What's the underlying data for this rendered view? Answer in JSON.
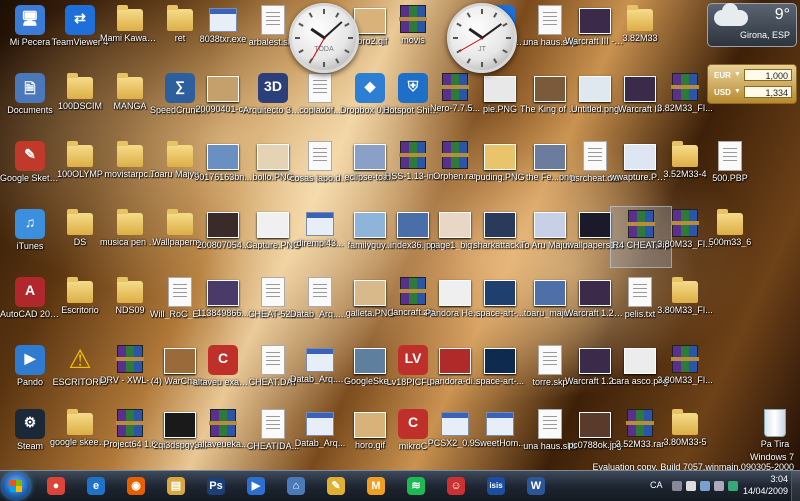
{
  "colors": {
    "taskbar": "#1e2632",
    "selection": "#a0bee6",
    "currency_panel": "#b88a2e"
  },
  "desktop": {
    "icons": [
      {
        "label": "Mi Pecera",
        "type": "app",
        "glyph": "🖥",
        "color": "#3a7bd5",
        "col": 0,
        "row": 0,
        "icon_name": "computer-icon"
      },
      {
        "label": "TeamViewer 4",
        "type": "app",
        "glyph": "⇄",
        "color": "#1e6fd9",
        "col": 1,
        "row": 0,
        "icon_name": "teamviewer-icon"
      },
      {
        "label": "Mami Kawada - ...",
        "type": "folder",
        "col": 2,
        "row": 0,
        "icon_name": "folder-icon"
      },
      {
        "label": "ret",
        "type": "folder",
        "col": 3,
        "row": 0,
        "icon_name": "folder-icon"
      },
      {
        "label": "8038txr.exe",
        "type": "exe",
        "col": 4,
        "row": 0,
        "icon_name": "exe-icon"
      },
      {
        "label": "arbalest.skp",
        "type": "doc",
        "col": 5,
        "row": 0,
        "icon_name": "sketchup-file-icon"
      },
      {
        "label": "horo2.gif",
        "type": "thumb",
        "color": "#d9b27a",
        "col": 7,
        "row": 0,
        "icon_name": "image-icon"
      },
      {
        "label": "movis",
        "type": "winrar",
        "col": 8,
        "row": 0,
        "icon_name": "winrar-icon"
      },
      {
        "label": "TeamViewe... (1).exe",
        "type": "app",
        "glyph": "⇄",
        "color": "#1e6fd9",
        "col": 10,
        "row": 0,
        "icon_name": "teamviewer-icon"
      },
      {
        "label": "una haus.skp",
        "type": "doc",
        "col": 11,
        "row": 0,
        "icon_name": "sketchup-file-icon"
      },
      {
        "label": "Warcraft III - The Frozen ...",
        "type": "thumb",
        "color": "#3b2a4a",
        "col": 12,
        "row": 0,
        "icon_name": "warcraft-icon"
      },
      {
        "label": "3.82M33",
        "type": "folder",
        "col": 13,
        "row": 0,
        "icon_name": "folder-icon"
      },
      {
        "label": "Documents",
        "type": "app",
        "glyph": "🗎",
        "color": "#4a78b8",
        "col": 0,
        "row": 1,
        "icon_name": "documents-icon"
      },
      {
        "label": "100DSCIM",
        "type": "folder",
        "col": 1,
        "row": 1,
        "icon_name": "folder-icon"
      },
      {
        "label": "MANGA",
        "type": "folder",
        "col": 2,
        "row": 1,
        "icon_name": "folder-icon"
      },
      {
        "label": "SpeedCrunch (calc)",
        "type": "app",
        "glyph": "∑",
        "color": "#2d5e9e",
        "col": 3,
        "row": 1,
        "icon_name": "calculator-icon"
      },
      {
        "label": "20090401-c...",
        "type": "thumb",
        "color": "#c5a06a",
        "col": 4,
        "row": 1,
        "icon_name": "image-icon"
      },
      {
        "label": "Arquitecto 3D 7.0",
        "type": "app",
        "glyph": "3D",
        "color": "#2b3f7a",
        "col": 5,
        "row": 1,
        "icon_name": "arquitecto-3d-icon"
      },
      {
        "label": "copiadof...",
        "type": "doc",
        "col": 6,
        "row": 1,
        "icon_name": "document-icon"
      },
      {
        "label": "Dropbox 0.6.402.exe",
        "type": "app",
        "glyph": "◆",
        "color": "#2d7fd3",
        "col": 7,
        "row": 1,
        "icon_name": "dropbox-icon"
      },
      {
        "label": "Hotspot Shield...",
        "type": "app",
        "glyph": "⛨",
        "color": "#1d6fc7",
        "col": 8,
        "row": 1,
        "icon_name": "hotspot-shield-icon"
      },
      {
        "label": "Nero-7.7.5...",
        "type": "winrar",
        "col": 9,
        "row": 1,
        "icon_name": "winrar-icon"
      },
      {
        "label": "pie.PNG",
        "type": "thumb",
        "color": "#e8e8e8",
        "col": 10,
        "row": 1,
        "icon_name": "image-icon"
      },
      {
        "label": "The King of Fallen...mp3",
        "type": "thumb",
        "color": "#7a5a3a",
        "col": 11,
        "row": 1,
        "icon_name": "audio-file-icon"
      },
      {
        "label": "Untitled.png",
        "type": "thumb",
        "color": "#dfe7ef",
        "col": 12,
        "row": 1,
        "icon_name": "image-icon"
      },
      {
        "label": "Warcraft III",
        "type": "thumb",
        "color": "#3b2a4a",
        "col": 13,
        "row": 1,
        "icon_name": "warcraft-icon"
      },
      {
        "label": "3.82M33_FI...",
        "type": "winrar",
        "col": 14,
        "row": 1,
        "icon_name": "winrar-icon"
      },
      {
        "label": "Google SketchUp",
        "type": "app",
        "glyph": "✎",
        "color": "#c0392b",
        "col": 0,
        "row": 2,
        "icon_name": "sketchup-icon"
      },
      {
        "label": "100OLYMP",
        "type": "folder",
        "col": 1,
        "row": 2,
        "icon_name": "folder-icon"
      },
      {
        "label": "movistarpc...",
        "type": "folder",
        "col": 2,
        "row": 2,
        "icon_name": "folder-icon"
      },
      {
        "label": "Toaru Majyutsu...",
        "type": "folder",
        "col": 3,
        "row": 2,
        "icon_name": "folder-icon"
      },
      {
        "label": "90176163bn...",
        "type": "thumb",
        "color": "#6a8fc2",
        "col": 4,
        "row": 2,
        "icon_name": "image-icon"
      },
      {
        "label": "bollo.PNG",
        "type": "thumb",
        "color": "#e5d3b5",
        "col": 5,
        "row": 2,
        "icon_name": "image-icon"
      },
      {
        "label": "cosas japo.docx",
        "type": "doc",
        "col": 6,
        "row": 2,
        "icon_name": "word-document-icon"
      },
      {
        "label": "eclipse-toa...",
        "type": "thumb",
        "color": "#8aa0c6",
        "col": 7,
        "row": 2,
        "icon_name": "image-icon"
      },
      {
        "label": "HSS-1.13-in...",
        "type": "winrar",
        "col": 8,
        "row": 2,
        "icon_name": "winrar-icon"
      },
      {
        "label": "Orphen.rar",
        "type": "winrar",
        "col": 9,
        "row": 2,
        "icon_name": "winrar-icon"
      },
      {
        "label": "puding.PNG",
        "type": "thumb",
        "color": "#e9c46a",
        "col": 10,
        "row": 2,
        "icon_name": "image-icon"
      },
      {
        "label": "the Fe...png",
        "type": "thumb",
        "color": "#6c7c9c",
        "col": 11,
        "row": 2,
        "icon_name": "image-icon"
      },
      {
        "label": "usrcheat.dat",
        "type": "doc",
        "col": 12,
        "row": 2,
        "icon_name": "file-icon"
      },
      {
        "label": "wwapture.PNG",
        "type": "thumb",
        "color": "#dde6f2",
        "col": 13,
        "row": 2,
        "icon_name": "image-icon"
      },
      {
        "label": "3.52M33-4",
        "type": "folder",
        "col": 14,
        "row": 2,
        "icon_name": "folder-icon"
      },
      {
        "label": "500.PBP",
        "type": "doc",
        "col": 15,
        "row": 2,
        "icon_name": "file-icon"
      },
      {
        "label": "iTunes",
        "type": "app",
        "glyph": "♫",
        "color": "#3b8fdc",
        "col": 0,
        "row": 3,
        "icon_name": "itunes-icon"
      },
      {
        "label": "DS",
        "type": "folder",
        "col": 1,
        "row": 3,
        "icon_name": "folder-icon"
      },
      {
        "label": "musica pen cotxe",
        "type": "folder",
        "col": 2,
        "row": 3,
        "icon_name": "folder-icon"
      },
      {
        "label": "Wallpaperm...",
        "type": "folder",
        "col": 3,
        "row": 3,
        "icon_name": "folder-icon"
      },
      {
        "label": "200807054...",
        "type": "thumb",
        "color": "#3a2a2a",
        "col": 4,
        "row": 3,
        "icon_name": "image-icon"
      },
      {
        "label": "Capture.PNG",
        "type": "thumb",
        "color": "#f0f0f0",
        "col": 5,
        "row": 3,
        "icon_name": "image-icon"
      },
      {
        "label": "dirempi43...",
        "type": "exe",
        "col": 6,
        "row": 3,
        "icon_name": "installer-icon"
      },
      {
        "label": "familyguy...",
        "type": "thumb",
        "color": "#8fb4d9",
        "col": 7,
        "row": 3,
        "icon_name": "image-icon"
      },
      {
        "label": "index36.jpg",
        "type": "thumb",
        "color": "#4a6fa8",
        "col": 8,
        "row": 3,
        "icon_name": "image-icon"
      },
      {
        "label": "page1_big...",
        "type": "thumb",
        "color": "#e8d7c5",
        "col": 9,
        "row": 3,
        "icon_name": "pdf-icon"
      },
      {
        "label": "sharkattack...",
        "type": "thumb",
        "color": "#2a3a5a",
        "col": 10,
        "row": 3,
        "icon_name": "image-icon"
      },
      {
        "label": "To Aru Majutsu n...",
        "type": "thumb",
        "color": "#c8d0e8",
        "col": 11,
        "row": 3,
        "icon_name": "image-icon"
      },
      {
        "label": "wallpapers1...",
        "type": "thumb",
        "color": "#1a1a2a",
        "col": 12,
        "row": 3,
        "icon_name": "image-icon"
      },
      {
        "label": "R4 CHEAT.zip",
        "type": "winrar",
        "col": 13,
        "row": 3,
        "selected": true,
        "icon_name": "winrar-icon"
      },
      {
        "label": "3.80M33_FI...",
        "type": "winrar",
        "col": 14,
        "row": 3,
        "icon_name": "winrar-icon"
      },
      {
        "label": "500m33_6",
        "type": "folder",
        "col": 15,
        "row": 3,
        "icon_name": "folder-icon"
      },
      {
        "label": "AutoCAD 2009 - E...",
        "type": "app",
        "glyph": "A",
        "color": "#b0282b",
        "col": 0,
        "row": 4,
        "icon_name": "autocad-icon"
      },
      {
        "label": "Escritorio",
        "type": "folder",
        "col": 1,
        "row": 4,
        "icon_name": "folder-icon"
      },
      {
        "label": "NDS09",
        "type": "folder",
        "col": 2,
        "row": 4,
        "icon_name": "folder-icon"
      },
      {
        "label": "Will_RoC_ES...",
        "type": "doc",
        "col": 3,
        "row": 4,
        "icon_name": "document-icon"
      },
      {
        "label": "113849866...",
        "type": "thumb",
        "color": "#4a3a6a",
        "col": 4,
        "row": 4,
        "icon_name": "image-icon"
      },
      {
        "label": "CHEAT-52...",
        "type": "doc",
        "col": 5,
        "row": 4,
        "icon_name": "file-icon"
      },
      {
        "label": "Datab_Arq... (1).lt",
        "type": "doc",
        "col": 6,
        "row": 4,
        "icon_name": "file-icon"
      },
      {
        "label": "galleta.PNG",
        "type": "thumb",
        "color": "#d8b98a",
        "col": 7,
        "row": 4,
        "icon_name": "image-icon"
      },
      {
        "label": "lancraft.zip",
        "type": "winrar",
        "col": 8,
        "row": 4,
        "icon_name": "winrar-icon"
      },
      {
        "label": "Pandora Hearts Tr...",
        "type": "thumb",
        "color": "#efefef",
        "col": 9,
        "row": 4,
        "icon_name": "audio-file-icon"
      },
      {
        "label": "space-art-...",
        "type": "thumb",
        "color": "#1f3f6f",
        "col": 10,
        "row": 4,
        "icon_name": "image-icon"
      },
      {
        "label": "toaru_maju...",
        "type": "thumb",
        "color": "#4f6fa8",
        "col": 11,
        "row": 4,
        "icon_name": "image-icon"
      },
      {
        "label": "Warcraft 1.21 Battle.net",
        "type": "thumb",
        "color": "#3b2a4a",
        "col": 12,
        "row": 4,
        "icon_name": "warcraft-icon"
      },
      {
        "label": "pelis.txt",
        "type": "doc",
        "col": 13,
        "row": 4,
        "icon_name": "text-file-icon"
      },
      {
        "label": "3.80M33_FI...",
        "type": "folder",
        "col": 14,
        "row": 4,
        "icon_name": "folder-icon"
      },
      {
        "label": "Pando",
        "type": "app",
        "glyph": "▶",
        "color": "#2e7bcf",
        "col": 0,
        "row": 5,
        "icon_name": "pando-icon"
      },
      {
        "label": "ESCRITORIS",
        "type": "caution",
        "col": 1,
        "row": 5,
        "icon_name": "warning-icon"
      },
      {
        "label": "DRV - XWL-11GU...",
        "type": "winrar",
        "col": 2,
        "row": 5,
        "icon_name": "winrar-icon"
      },
      {
        "label": "(4) WarChas...",
        "type": "thumb",
        "color": "#9b6a3a",
        "col": 3,
        "row": 5,
        "icon_name": "scroll-icon"
      },
      {
        "label": "altaveu examen.c",
        "type": "app",
        "glyph": "C",
        "color": "#c0302b",
        "col": 4,
        "row": 5,
        "icon_name": "c-source-icon"
      },
      {
        "label": "CHEAT.DAT",
        "type": "doc",
        "col": 5,
        "row": 5,
        "icon_name": "file-icon"
      },
      {
        "label": "Datab_Arq... (1).exe",
        "type": "exe",
        "col": 6,
        "row": 5,
        "icon_name": "installer-icon"
      },
      {
        "label": "GoogleSke...",
        "type": "thumb",
        "color": "#5f7f9f",
        "col": 7,
        "row": 5,
        "icon_name": "image-icon"
      },
      {
        "label": "Lv18PICFL...",
        "type": "app",
        "glyph": "LV",
        "color": "#c0302b",
        "col": 8,
        "row": 5,
        "icon_name": "lv-pic-icon"
      },
      {
        "label": "pandora-di...",
        "type": "thumb",
        "color": "#b02a2a",
        "col": 9,
        "row": 5,
        "icon_name": "image-icon"
      },
      {
        "label": "space-art-...",
        "type": "thumb",
        "color": "#0f2a4f",
        "col": 10,
        "row": 5,
        "icon_name": "image-icon"
      },
      {
        "label": "torre.skp",
        "type": "doc",
        "col": 11,
        "row": 5,
        "icon_name": "sketchup-file-icon"
      },
      {
        "label": "Warcraft 1.21 PvPgn",
        "type": "thumb",
        "color": "#3b2a4a",
        "col": 12,
        "row": 5,
        "icon_name": "warcraft-icon"
      },
      {
        "label": "cara asco.png",
        "type": "thumb",
        "color": "#ececec",
        "col": 13,
        "row": 5,
        "icon_name": "image-icon"
      },
      {
        "label": "3.80M33_FI...",
        "type": "winrar",
        "col": 14,
        "row": 5,
        "icon_name": "winrar-icon"
      },
      {
        "label": "Steam",
        "type": "app",
        "glyph": "⚙",
        "color": "#1b2838",
        "col": 0,
        "row": 6,
        "icon_name": "steam-icon"
      },
      {
        "label": "google skeetchup",
        "type": "folder",
        "col": 1,
        "row": 6,
        "icon_name": "folder-icon"
      },
      {
        "label": "Project64 1.6",
        "type": "winrar",
        "col": 2,
        "row": 6,
        "icon_name": "winrar-icon"
      },
      {
        "label": "2qi3dspgy3...",
        "type": "thumb",
        "color": "#1a1a1a",
        "col": 3,
        "row": 6,
        "icon_name": "image-icon"
      },
      {
        "label": "altaveueka...",
        "type": "winrar",
        "col": 4,
        "row": 6,
        "icon_name": "winrar-icon"
      },
      {
        "label": "CHEATIDA...",
        "type": "doc",
        "col": 5,
        "row": 6,
        "icon_name": "file-icon"
      },
      {
        "label": "Datab_Arq...",
        "type": "exe",
        "col": 6,
        "row": 6,
        "icon_name": "installer-icon"
      },
      {
        "label": "horo.gif",
        "type": "thumb",
        "color": "#d9b27a",
        "col": 7,
        "row": 6,
        "icon_name": "image-icon"
      },
      {
        "label": "mikroC",
        "type": "app",
        "glyph": "C",
        "color": "#c0302b",
        "col": 8,
        "row": 6,
        "icon_name": "mikroc-icon"
      },
      {
        "label": "PCSX2_0.9...",
        "type": "exe",
        "col": 9,
        "row": 6,
        "icon_name": "installer-icon"
      },
      {
        "label": "SweetHom...",
        "type": "exe",
        "col": 10,
        "row": 6,
        "icon_name": "installer-icon"
      },
      {
        "label": "una haus.skb",
        "type": "doc",
        "col": 11,
        "row": 6,
        "icon_name": "sketchup-file-icon"
      },
      {
        "label": "pc0788ok.jpg",
        "type": "thumb",
        "color": "#5a3a2a",
        "col": 12,
        "row": 6,
        "icon_name": "image-icon"
      },
      {
        "label": "3.52M33.rar",
        "type": "winrar",
        "col": 13,
        "row": 6,
        "icon_name": "winrar-icon"
      },
      {
        "label": "3.80M33-5",
        "type": "folder",
        "col": 14,
        "row": 6,
        "icon_name": "folder-icon"
      }
    ],
    "recycle_bin": {
      "label": "Pa Tira",
      "icon_name": "recycle-bin-icon"
    }
  },
  "gadgets": {
    "clock1": {
      "zone": "TODA",
      "hour": 10,
      "minute": 8,
      "second": 35
    },
    "clock2": {
      "zone": "JT",
      "hour": 10,
      "minute": 9,
      "second": 40
    },
    "weather": {
      "temp": "9°",
      "city": "Girona, ESP",
      "icon_name": "cloud-icon"
    },
    "currency": {
      "rows": [
        {
          "code": "EUR",
          "value": "1,000"
        },
        {
          "code": "USD",
          "value": "1,334"
        }
      ]
    }
  },
  "watermark": {
    "line1": "Windows 7",
    "line2": "Evaluation copy. Build 7057.winmain.090305-2000"
  },
  "taskbar": {
    "start_label": "Start",
    "pinned": [
      {
        "name": "chrome",
        "glyph": "●",
        "color": "#db4437",
        "icon_name": "chrome-icon"
      },
      {
        "name": "internet-explorer",
        "glyph": "e",
        "color": "#1e73c9",
        "icon_name": "internet-explorer-icon"
      },
      {
        "name": "firefox",
        "glyph": "◉",
        "color": "#e66000",
        "icon_name": "firefox-icon"
      },
      {
        "name": "explorer",
        "glyph": "▤",
        "color": "#d9a840",
        "icon_name": "folder-icon"
      },
      {
        "name": "photoshop",
        "glyph": "Ps",
        "color": "#1c3f78",
        "icon_name": "photoshop-icon"
      },
      {
        "name": "windows-media-player",
        "glyph": "▶",
        "color": "#2d6fd0",
        "icon_name": "media-player-icon"
      },
      {
        "name": "network",
        "glyph": "⌂",
        "color": "#4a7ab8",
        "icon_name": "network-icon"
      },
      {
        "name": "pencil-app",
        "glyph": "✎",
        "color": "#e0b030",
        "icon_name": "pencil-icon"
      },
      {
        "name": "messenger",
        "glyph": "M",
        "color": "#f0a020",
        "icon_name": "messenger-icon"
      },
      {
        "name": "spotify",
        "glyph": "≋",
        "color": "#1db954",
        "icon_name": "spotify-icon"
      },
      {
        "name": "game",
        "glyph": "☺",
        "color": "#cc3030",
        "icon_name": "game-icon"
      },
      {
        "name": "isis",
        "glyph": "isis",
        "color": "#1c4ea0",
        "icon_name": "isis-icon"
      },
      {
        "name": "word",
        "glyph": "W",
        "color": "#2b579a",
        "icon_name": "word-icon"
      }
    ],
    "tray": {
      "language": "CA",
      "time": "3:04",
      "date": "14/04/2009"
    }
  }
}
